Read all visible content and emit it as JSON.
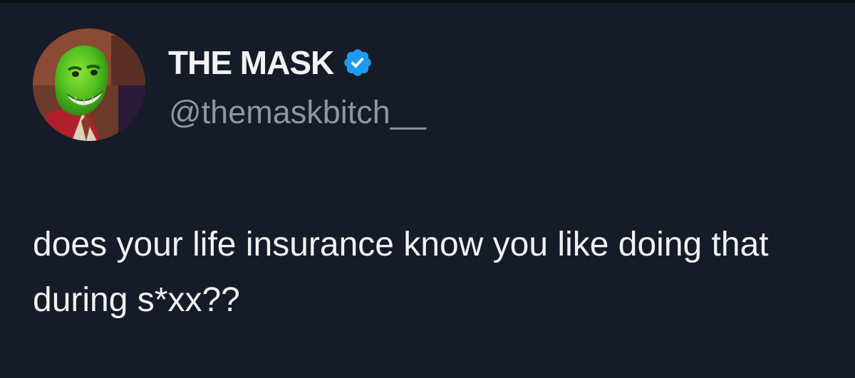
{
  "tweet": {
    "author": {
      "display_name": "THE MASK",
      "handle": "@themaskbitch__",
      "verified": true,
      "avatar": "green-masked-character-avatar"
    },
    "text": "does your life insurance know you like doing that during s*xx??"
  },
  "icons": {
    "verified": "verified-badge-icon"
  },
  "colors": {
    "background": "#151b27",
    "name": "#f2f2f2",
    "handle": "#8b97a6",
    "verified_badge": "#1d9bf0",
    "text": "#f1f1f1"
  }
}
